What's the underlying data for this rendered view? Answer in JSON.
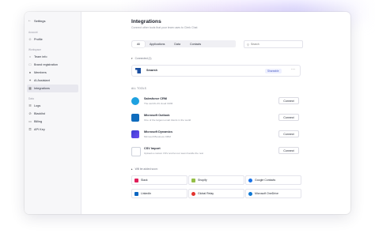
{
  "sidebar": {
    "header": "Settings",
    "sections": [
      {
        "label": "Account",
        "items": [
          {
            "label": "Profile",
            "icon": "user-icon"
          }
        ]
      },
      {
        "label": "Workspace",
        "items": [
          {
            "label": "Team info",
            "icon": "team-icon"
          },
          {
            "label": "Brand registration",
            "icon": "brand-icon"
          },
          {
            "label": "Members",
            "icon": "members-icon"
          },
          {
            "label": "AI Assistant",
            "icon": "sparkle-icon"
          },
          {
            "label": "Integrations",
            "icon": "integrations-icon",
            "active": true
          }
        ]
      },
      {
        "label": "Data",
        "items": [
          {
            "label": "Logs",
            "icon": "logs-icon"
          },
          {
            "label": "Blacklist",
            "icon": "blacklist-icon"
          },
          {
            "label": "Billing",
            "icon": "billing-icon"
          },
          {
            "label": "API Key",
            "icon": "key-icon"
          }
        ]
      }
    ]
  },
  "main": {
    "title": "Integrations",
    "subtitle": "Connect other tools that your team uses to Clerk Chat",
    "tabs": [
      "All",
      "Applications",
      "Data",
      "Contacts"
    ],
    "active_tab": "All",
    "search_placeholder": "Search"
  },
  "connected": {
    "label": "Connected (1)",
    "items": [
      {
        "name": "Smarsh",
        "badge": "Shareable"
      }
    ]
  },
  "all_tools": {
    "label": "ALL TOOLS",
    "items": [
      {
        "name": "Salesforce CRM",
        "desc": "The world's #1 cloud CRM",
        "button": "Connect",
        "color": "#1ea1e0"
      },
      {
        "name": "Microsoft Outlook",
        "desc": "One of the largest email clients in the world",
        "button": "Connect",
        "color": "#0f6cbd"
      },
      {
        "name": "Microsoft Dynamics",
        "desc": "Microsoft Business CRM",
        "button": "Connect",
        "color": "#3b3bd1"
      },
      {
        "name": "CSV Import",
        "desc": "Upload a custom CSV and let our team handle the rest",
        "button": "Connect",
        "color": "#ffffff"
      }
    ]
  },
  "coming_soon": {
    "label": "Will be added soon:",
    "items": [
      {
        "name": "Slack",
        "color": "#e01e5a"
      },
      {
        "name": "Shopify",
        "color": "#95bf47"
      },
      {
        "name": "Google Contacts",
        "color": "#1a73e8"
      },
      {
        "name": "LinkedIn",
        "color": "#0a66c2"
      },
      {
        "name": "Global Relay",
        "color": "#e3342f"
      },
      {
        "name": "Microsoft OneDrive",
        "color": "#0f78d4"
      }
    ]
  }
}
